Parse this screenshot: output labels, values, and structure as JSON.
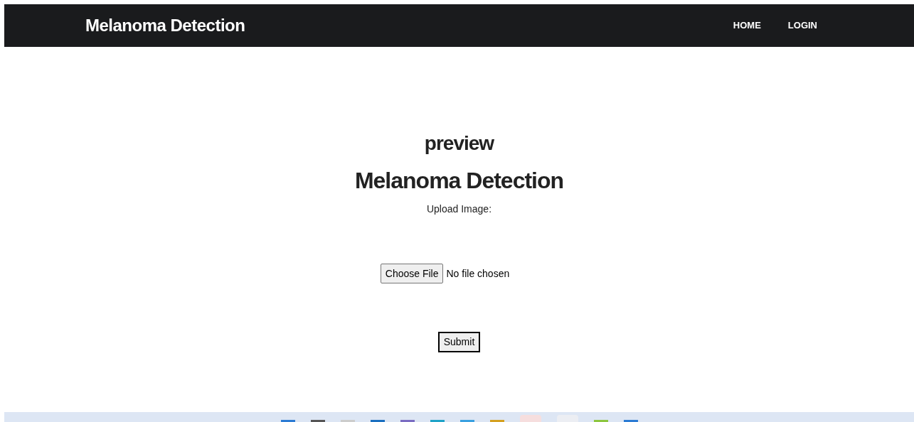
{
  "navbar": {
    "brand": "Melanoma Detection",
    "links": [
      "HOME",
      "LOGIN"
    ]
  },
  "main": {
    "subtitle": "preview",
    "title": "Melanoma Detection",
    "upload_label": "Upload Image:",
    "file_button": "Choose File",
    "file_status": "No file chosen",
    "submit": "Submit"
  }
}
